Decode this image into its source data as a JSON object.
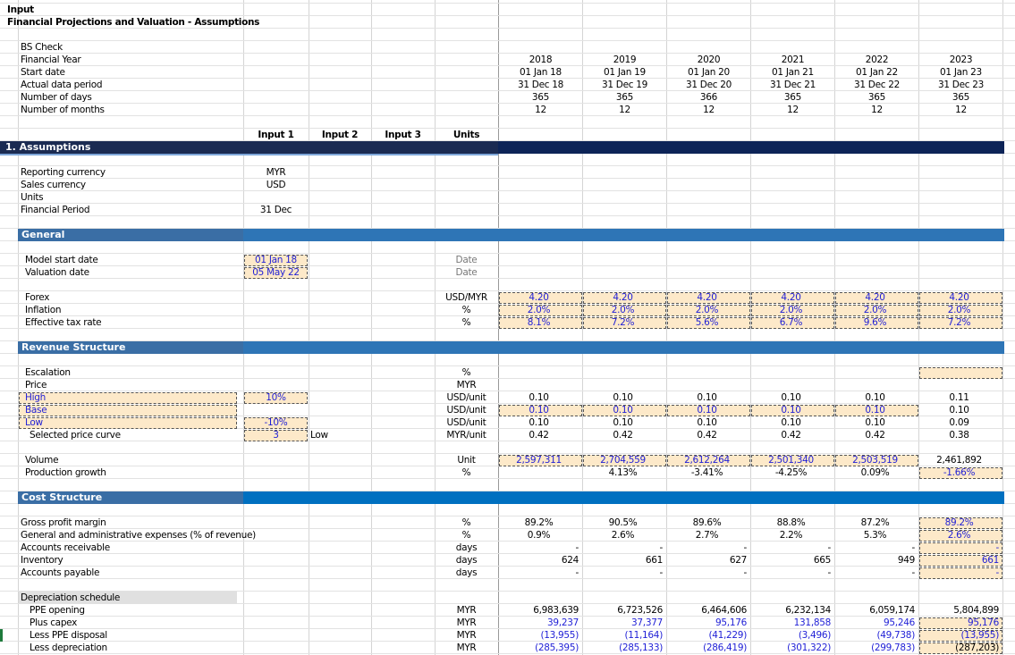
{
  "title": "Input",
  "subtitle": "Financial Projections and Valuation - Assumptions",
  "top_labels": [
    "BS Check",
    "Financial Year",
    "Start date",
    "Actual data period",
    "Number of days",
    "Number of months"
  ],
  "years": [
    {
      "year": "2018",
      "start": "01 Jan 18",
      "end": "31 Dec 18",
      "days": "365",
      "months": "12"
    },
    {
      "year": "2019",
      "start": "01 Jan 19",
      "end": "31 Dec 19",
      "days": "365",
      "months": "12"
    },
    {
      "year": "2020",
      "start": "01 Jan 20",
      "end": "31 Dec 20",
      "days": "366",
      "months": "12"
    },
    {
      "year": "2021",
      "start": "01 Jan 21",
      "end": "31 Dec 21",
      "days": "365",
      "months": "12"
    },
    {
      "year": "2022",
      "start": "01 Jan 22",
      "end": "31 Dec 22",
      "days": "365",
      "months": "12"
    },
    {
      "year": "2023",
      "start": "01 Jan 23",
      "end": "31 Dec 23",
      "days": "365",
      "months": "12"
    }
  ],
  "col_headers": {
    "input1": "Input 1",
    "input2": "Input 2",
    "input3": "Input 3",
    "units": "Units"
  },
  "sections": {
    "assumptions": "1. Assumptions",
    "general": "General",
    "revenue": "Revenue Structure",
    "cost": "Cost Structure"
  },
  "assumptions": [
    {
      "label": "Reporting currency",
      "value": "MYR"
    },
    {
      "label": "Sales currency",
      "value": "USD"
    },
    {
      "label": "Units",
      "value": ""
    },
    {
      "label": "Financial Period",
      "value": "31 Dec"
    }
  ],
  "general": {
    "model_start": {
      "label": "Model start date",
      "value": "01 Jan 18",
      "unit": "Date"
    },
    "valuation": {
      "label": "Valuation date",
      "value": "05 May 22",
      "unit": "Date"
    },
    "forex": {
      "label": "Forex",
      "unit": "USD/MYR",
      "values": [
        "4.20",
        "4.20",
        "4.20",
        "4.20",
        "4.20",
        "4.20"
      ]
    },
    "inflation": {
      "label": "Inflation",
      "unit": "%",
      "values": [
        "2.0%",
        "2.0%",
        "2.0%",
        "2.0%",
        "2.0%",
        "2.0%"
      ]
    },
    "tax": {
      "label": "Effective tax rate",
      "unit": "%",
      "values": [
        "8.1%",
        "7.2%",
        "5.6%",
        "6.7%",
        "9.6%",
        "7.2%"
      ]
    }
  },
  "revenue": {
    "escalation": {
      "label": "Escalation",
      "unit": "%"
    },
    "price": {
      "label": "Price",
      "unit": "MYR"
    },
    "high": {
      "label": "High",
      "input": "10%",
      "unit": "USD/unit",
      "values": [
        "0.10",
        "0.10",
        "0.10",
        "0.10",
        "0.10",
        "0.11"
      ]
    },
    "base": {
      "label": "Base",
      "unit": "USD/unit",
      "values": [
        "0.10",
        "0.10",
        "0.10",
        "0.10",
        "0.10",
        "0.10"
      ]
    },
    "low": {
      "label": "Low",
      "input": "-10%",
      "unit": "USD/unit",
      "values": [
        "0.10",
        "0.10",
        "0.10",
        "0.10",
        "0.10",
        "0.09"
      ]
    },
    "selected": {
      "label": "Selected price curve",
      "input": "3",
      "input2": "Low",
      "unit": "MYR/unit",
      "values": [
        "0.42",
        "0.42",
        "0.42",
        "0.42",
        "0.42",
        "0.38"
      ]
    },
    "volume": {
      "label": "Volume",
      "unit": "Unit",
      "values": [
        "2,597,311",
        "2,704,559",
        "2,612,264",
        "2,501,340",
        "2,503,519",
        "2,461,892"
      ]
    },
    "growth": {
      "label": "Production growth",
      "unit": "%",
      "values": [
        "",
        "4.13%",
        "-3.41%",
        "-4.25%",
        "0.09%",
        "-1.66%"
      ]
    }
  },
  "cost": {
    "gpm": {
      "label": "Gross profit margin",
      "unit": "%",
      "values": [
        "89.2%",
        "90.5%",
        "89.6%",
        "88.8%",
        "87.2%",
        "89.2%"
      ]
    },
    "gae": {
      "label": "General and administrative expenses (% of revenue)",
      "unit": "%",
      "values": [
        "0.9%",
        "2.6%",
        "2.7%",
        "2.2%",
        "5.3%",
        "2.6%"
      ]
    },
    "ar": {
      "label": "Accounts receivable",
      "unit": "days",
      "values": [
        "-",
        "-",
        "-",
        "-",
        "-",
        "-"
      ]
    },
    "inv": {
      "label": "Inventory",
      "unit": "days",
      "values": [
        "624",
        "661",
        "627",
        "665",
        "949",
        "661"
      ]
    },
    "ap": {
      "label": "Accounts payable",
      "unit": "days",
      "values": [
        "-",
        "-",
        "-",
        "-",
        "-",
        "-"
      ]
    },
    "dep_header": "Depreciation schedule",
    "ppe": {
      "label": "PPE opening",
      "unit": "MYR",
      "values": [
        "6,983,639",
        "6,723,526",
        "6,464,606",
        "6,232,134",
        "6,059,174",
        "5,804,899"
      ]
    },
    "capex": {
      "label": "Plus capex",
      "unit": "MYR",
      "values": [
        "39,237",
        "37,377",
        "95,176",
        "131,858",
        "95,246",
        "95,176"
      ]
    },
    "disposal": {
      "label": "Less PPE disposal",
      "unit": "MYR",
      "values": [
        "(13,955)",
        "(11,164)",
        "(41,229)",
        "(3,496)",
        "(49,738)",
        "(13,955)"
      ]
    },
    "depr": {
      "label": "Less depreciation",
      "unit": "MYR",
      "values": [
        "(285,395)",
        "(285,133)",
        "(286,419)",
        "(301,322)",
        "(299,783)",
        "(287,203)"
      ]
    }
  }
}
